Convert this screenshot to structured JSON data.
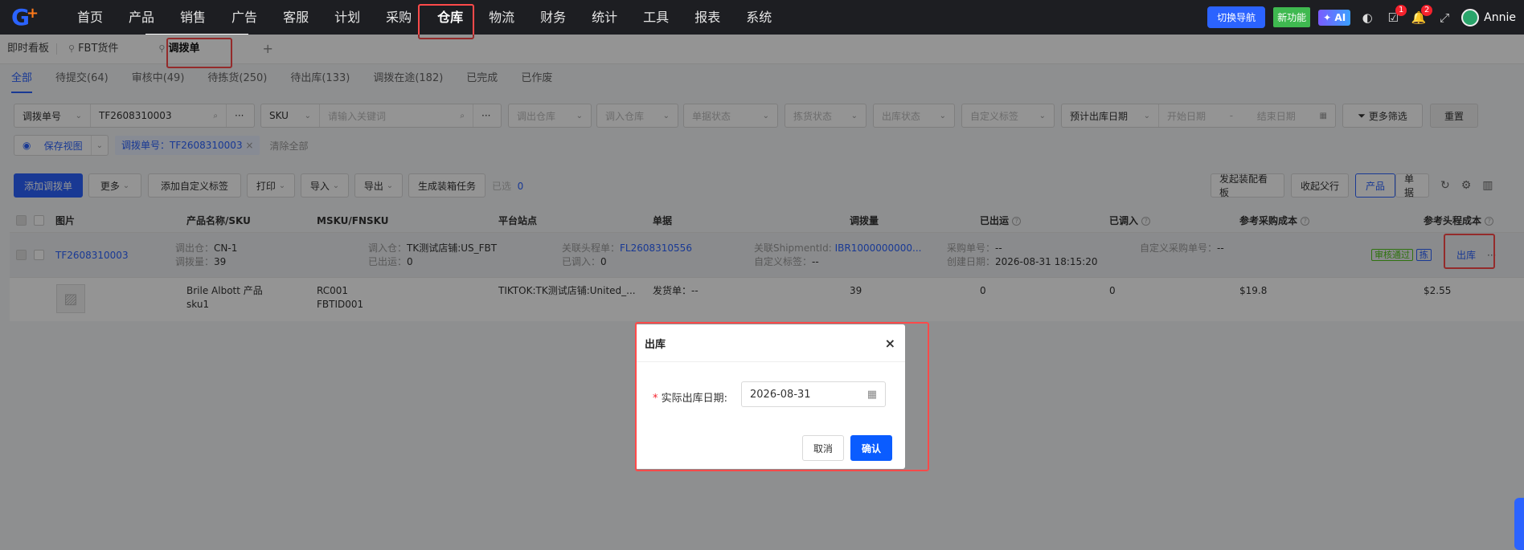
{
  "topnav": {
    "logo": "G",
    "items": [
      "首页",
      "产品",
      "销售",
      "广告",
      "客服",
      "计划",
      "采购",
      "仓库",
      "物流",
      "财务",
      "统计",
      "工具",
      "报表",
      "系统"
    ],
    "active": "仓库",
    "switch_nav": "切换导航",
    "new_feature": "新功能",
    "ai": "AI",
    "task_badge": "1",
    "bell_badge": "2",
    "user": "Annie"
  },
  "tabs": {
    "dashboard": "即时看板",
    "fbt": "FBT货件",
    "transfer": "调拨单"
  },
  "status_tabs": [
    "全部",
    "待提交(64)",
    "审核中(49)",
    "待拣货(250)",
    "待出库(133)",
    "调拨在途(182)",
    "已完成",
    "已作废"
  ],
  "filters": {
    "search_type": "调拨单号",
    "search_value": "TF2608310003",
    "sku_type": "SKU",
    "sku_placeholder": "请输入关键词",
    "out_wh": "调出仓库",
    "in_wh": "调入仓库",
    "doc_status": "单据状态",
    "pick_status": "拣货状态",
    "out_status": "出库状态",
    "custom_tag": "自定义标签",
    "date_type": "预计出库日期",
    "start_date": "开始日期",
    "end_date": "结束日期",
    "more_filters": "更多筛选",
    "reset": "重置",
    "save_view": "保存视图",
    "active_filter": "调拨单号：TF2608310003",
    "clear_all": "清除全部"
  },
  "toolbar": {
    "add": "添加调拨单",
    "more": "更多",
    "add_tag": "添加自定义标签",
    "print": "打印",
    "import": "导入",
    "export": "导出",
    "gen_task": "生成装箱任务",
    "selected_label": "已选",
    "selected_count": "0",
    "dispatch_board": "发起装配看板",
    "collapse": "收起父行",
    "view_product": "产品",
    "view_doc": "单据"
  },
  "table": {
    "headers": [
      "图片",
      "产品名称/SKU",
      "MSKU/FNSKU",
      "平台站点",
      "单据",
      "调拨量",
      "已出运",
      "已调入",
      "参考采购成本",
      "参考头程成本"
    ],
    "parent": {
      "id": "TF2608310003",
      "out_wh_label": "调出仓：",
      "out_wh": "CN-1",
      "qty_label": "调拨量：",
      "qty": "39",
      "in_wh_label": "调入仓：",
      "in_wh": "TK测试店铺:US_FBT",
      "shipped_label": "已出运：",
      "shipped": "0",
      "head_label": "关联头程单：",
      "head": "FL2608310556",
      "received_label": "已调入：",
      "received": "0",
      "shipment_label": "关联ShipmentId:",
      "shipment": "IBR1000000000...",
      "tag_label": "自定义标签：",
      "tag": "--",
      "po_label": "采购单号：",
      "po": "--",
      "created_label": "创建日期：",
      "created": "2026-08-31 18:15:20",
      "custom_po_label": "自定义采购单号：",
      "custom_po": "--",
      "approved": "审核通过",
      "pick": "拣",
      "action": "出库",
      "more": "···"
    },
    "child": {
      "name": "Brile Albott 产品",
      "sku": "sku1",
      "msku": "RC001",
      "fnsku": "FBTID001",
      "platform": "TIKTOK:TK测试店铺:United_...",
      "doc": "发货单：--",
      "qty": "39",
      "shipped": "0",
      "received": "0",
      "po_cost": "$19.8",
      "head_cost": "$2.55"
    }
  },
  "modal": {
    "title": "出库",
    "label": "实际出库日期",
    "date": "2026-08-31",
    "cancel": "取消",
    "confirm": "确认"
  },
  "colors": {
    "primary": "#2b63ff",
    "highlight": "#ff4a4a",
    "success": "#52c41a"
  }
}
